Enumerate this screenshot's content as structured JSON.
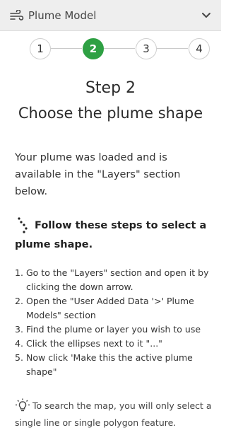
{
  "header": {
    "title": "Plume Model",
    "icon": "wind-icon",
    "toggle_icon": "chevron-down-icon"
  },
  "stepper": {
    "steps": [
      "1",
      "2",
      "3",
      "4"
    ],
    "active": "2",
    "active_color": "#2ea043"
  },
  "content": {
    "step_title": "Step 2",
    "step_subtitle": "Choose the plume shape",
    "intro": "Your plume was loaded and is available in the \"Layers\" section below.",
    "follow_heading": "Follow these steps to select a plume shape.",
    "instructions": [
      "Go to the \"Layers\" section and open it by clicking the down arrow.",
      "Open the \"User Added Data '>' Plume Models\" section",
      "Find the plume or layer you wish to use",
      "Click the ellipses next to it \"...\"",
      "Now click 'Make this the active plume shape\""
    ],
    "tip": "To search the map, you will only select a single line or single polygon feature."
  }
}
